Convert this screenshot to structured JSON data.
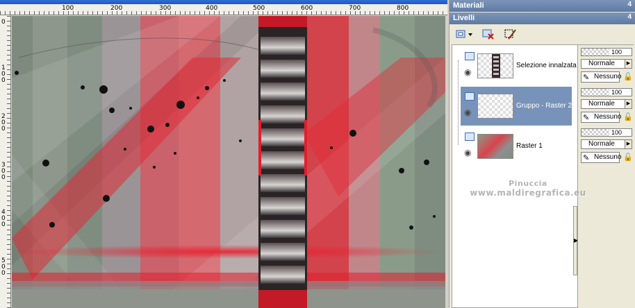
{
  "rulers": {
    "top_labels": [
      "100",
      "200",
      "300",
      "400",
      "500",
      "600",
      "700",
      "800"
    ],
    "left_labels": [
      "0",
      "100",
      "200",
      "300",
      "400",
      "500"
    ]
  },
  "panels": {
    "materials": {
      "title": "Materiali",
      "pin": "4"
    },
    "layers": {
      "title": "Livelli",
      "pin": "4"
    }
  },
  "layers": [
    {
      "name": "Selezione innalzata",
      "opacity": "100",
      "blend": "Normale",
      "mask": "Nessuno"
    },
    {
      "name": "Gruppo - Raster 2",
      "opacity": "100",
      "blend": "Normale",
      "mask": "Nessuno"
    },
    {
      "name": "Raster 1",
      "opacity": "100",
      "blend": "Normale",
      "mask": "Nessuno"
    }
  ],
  "watermark": {
    "line1": "Pinuccia",
    "line2": "www.maldiregrafica.eu"
  },
  "colors": {
    "accent_red": "#e21e2d",
    "sage": "#8a9a88",
    "selected_row": "#7893b9"
  }
}
